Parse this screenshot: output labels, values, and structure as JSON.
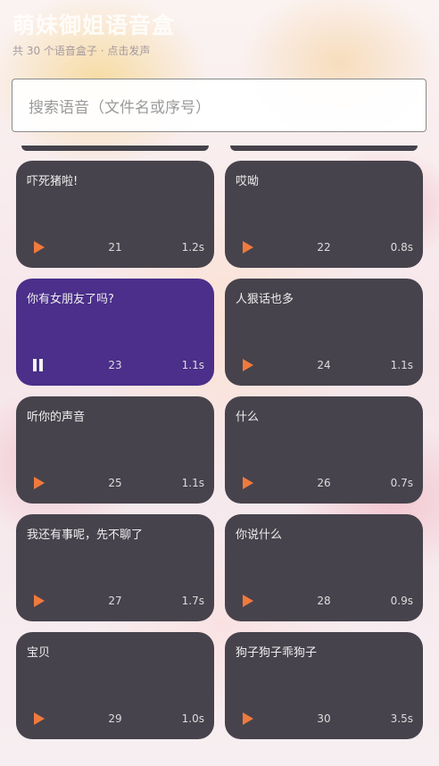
{
  "header": {
    "title": "萌妹御姐语音盒",
    "subtitle": "共 30 个语音盒子 · 点击发声"
  },
  "search": {
    "placeholder": "搜索语音（文件名或序号）"
  },
  "colors": {
    "card": "#47434c",
    "card_playing": "#4b2f8a",
    "play_icon": "#f07a3d",
    "pause_icon": "#f2f2f2"
  },
  "cards": [
    {
      "label": "吓死猪啦!",
      "number": "21",
      "duration": "1.2s",
      "state": "idle",
      "icon": "play-icon"
    },
    {
      "label": "哎呦",
      "number": "22",
      "duration": "0.8s",
      "state": "idle",
      "icon": "play-icon"
    },
    {
      "label": "你有女朋友了吗?",
      "number": "23",
      "duration": "1.1s",
      "state": "playing",
      "icon": "pause-icon"
    },
    {
      "label": "人狠话也多",
      "number": "24",
      "duration": "1.1s",
      "state": "idle",
      "icon": "play-icon"
    },
    {
      "label": "听你的声音",
      "number": "25",
      "duration": "1.1s",
      "state": "idle",
      "icon": "play-icon"
    },
    {
      "label": "什么",
      "number": "26",
      "duration": "0.7s",
      "state": "idle",
      "icon": "play-icon"
    },
    {
      "label": "我还有事呢，先不聊了",
      "number": "27",
      "duration": "1.7s",
      "state": "idle",
      "icon": "play-icon"
    },
    {
      "label": "你说什么",
      "number": "28",
      "duration": "0.9s",
      "state": "idle",
      "icon": "play-icon"
    },
    {
      "label": "宝贝",
      "number": "29",
      "duration": "1.0s",
      "state": "idle",
      "icon": "play-icon"
    },
    {
      "label": "狗子狗子乖狗子",
      "number": "30",
      "duration": "3.5s",
      "state": "idle",
      "icon": "play-icon"
    }
  ]
}
